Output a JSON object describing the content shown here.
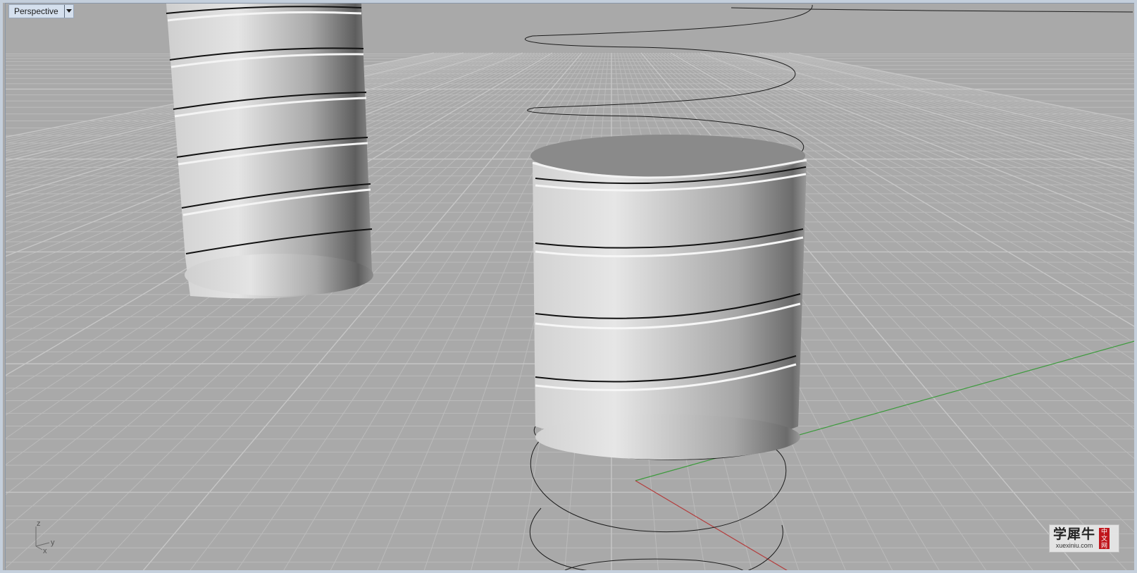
{
  "viewport": {
    "title": "Perspective",
    "menu_icon": "chevron-down-icon"
  },
  "axis_widget": {
    "z": "z",
    "y": "y",
    "x": "x"
  },
  "watermark": {
    "logo_text": "学犀牛",
    "url": "xuexiniu.com",
    "seal": [
      "中",
      "文",
      "网"
    ]
  },
  "colors": {
    "background": "#a9a9a9",
    "grid": "#b8b8b8",
    "x_axis": "#b43c3c",
    "y_axis": "#3c9a3c",
    "frame": "#c4cfdc"
  }
}
